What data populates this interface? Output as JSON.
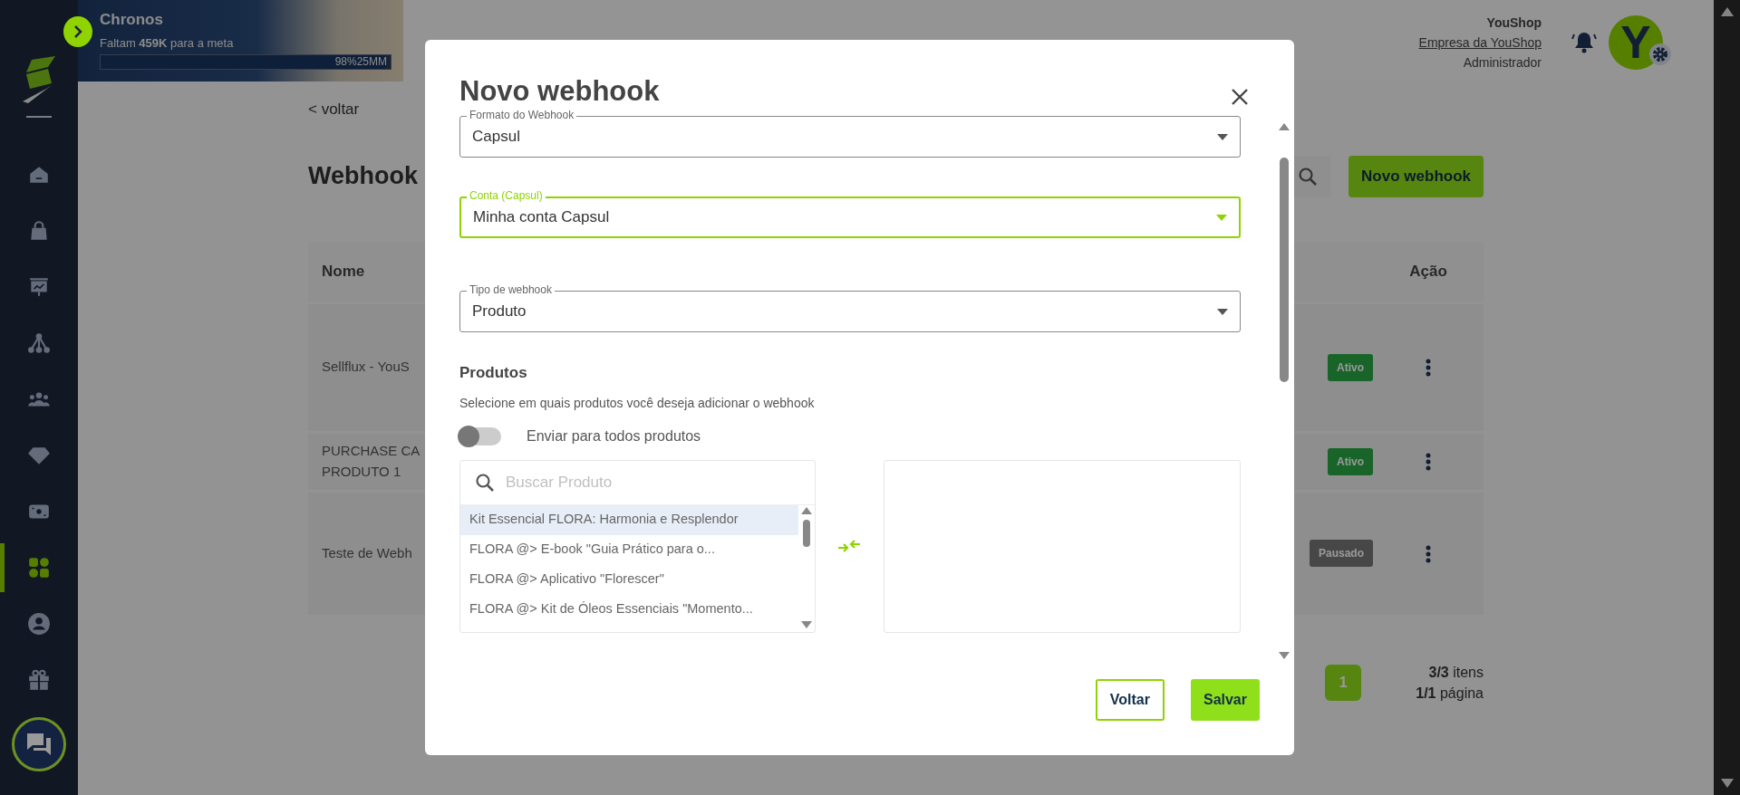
{
  "banner": {
    "title": "Chronos",
    "goal_text": "Faltam **459K** para a meta",
    "progress": {
      "level": 0.98,
      "reading": "98%25MM"
    }
  },
  "header": {
    "company": "YouShop",
    "company_link": "Empresa da YouShop",
    "role": "Administrador",
    "avatar_letter": "Y"
  },
  "sidebar": {
    "items": [
      {
        "kind": "home",
        "selected": false
      },
      {
        "kind": "bag",
        "selected": false
      },
      {
        "kind": "presentation",
        "selected": false
      },
      {
        "kind": "network",
        "selected": false
      },
      {
        "kind": "group",
        "selected": false
      },
      {
        "kind": "diamond",
        "selected": false
      },
      {
        "kind": "money",
        "selected": false
      },
      {
        "kind": "apps",
        "selected": true
      },
      {
        "kind": "user",
        "selected": false
      },
      {
        "kind": "gift",
        "selected": false
      }
    ]
  },
  "page": {
    "back_link": "< voltar",
    "title": "Webhook",
    "new_button": "Novo webhook",
    "table": {
      "columns": [
        "Nome",
        "Ação"
      ],
      "rows": [
        {
          "name": [
            "Sellflux - YouS"
          ],
          "status": "Ativo",
          "kind": "active"
        },
        {
          "name": [
            "PURCHASE CA",
            "PRODUTO 1"
          ],
          "status": "Ativo",
          "kind": "active"
        },
        {
          "name": [
            "Teste de Webh"
          ],
          "status": "Pausado",
          "kind": "paused"
        }
      ]
    },
    "pagination": {
      "pages": [
        {
          "label": "1",
          "selected": true
        }
      ],
      "items": "**3/3** itens",
      "page_info": "**1/1** página"
    }
  },
  "modal": {
    "title": "Novo webhook",
    "fields": [
      {
        "label": "Formato do Webhook",
        "value": "Capsul",
        "focused": false
      },
      {
        "label": "Conta (Capsul)",
        "value": "Minha conta Capsul",
        "focused": true
      },
      {
        "label": "Tipo de webhook",
        "value": "Produto",
        "focused": false
      }
    ],
    "products": {
      "heading": "Produtos",
      "description": "Selecione em quais produtos você deseja adicionar o webhook",
      "toggle": {
        "label": "Enviar para todos produtos",
        "on": false
      },
      "search": {
        "placeholder": "Buscar Produto"
      },
      "available": [
        {
          "label": "Kit Essencial FLORA: Harmonia e Resplendor",
          "selected": true
        },
        {
          "label": "FLORA @> E-book \"Guia Prático para o...",
          "selected": false
        },
        {
          "label": "FLORA @> Aplicativo \"Florescer\"",
          "selected": false
        },
        {
          "label": "FLORA @> Kit de Óleos Essenciais \"Momento...",
          "selected": false
        }
      ]
    },
    "buttons": [
      {
        "label": "Voltar",
        "kind": "outline"
      },
      {
        "label": "Salvar",
        "kind": "primary"
      }
    ]
  }
}
